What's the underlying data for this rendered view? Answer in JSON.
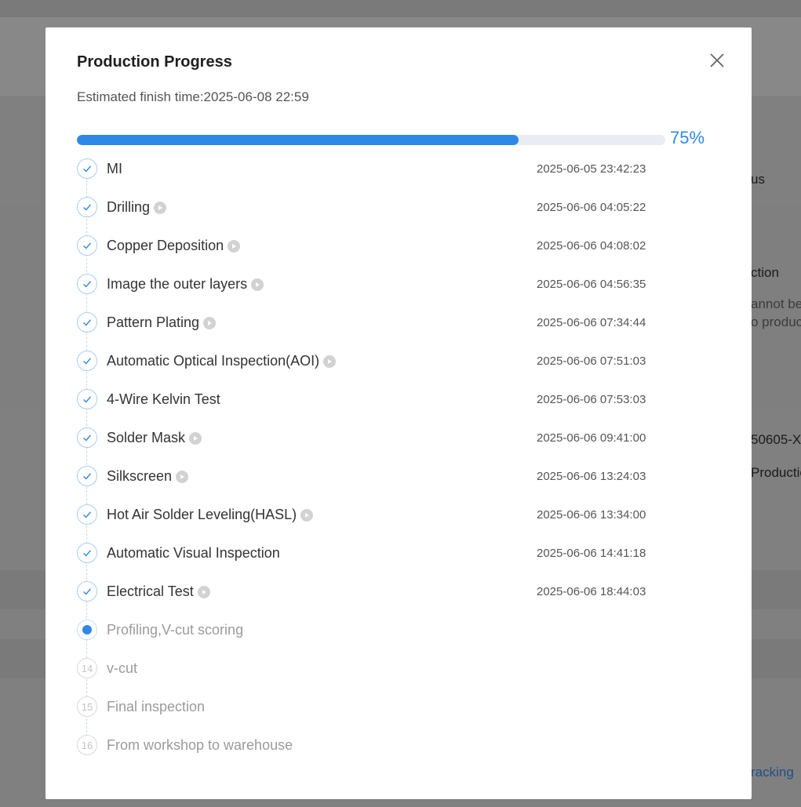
{
  "background": {
    "fragments": [
      "us",
      "ction",
      "annot be",
      "o produc",
      "50605-X",
      "Productio",
      "racking"
    ]
  },
  "modal": {
    "title": "Production Progress",
    "close_icon": "close-icon",
    "estimated_finish": "Estimated finish time:2025-06-08 22:59",
    "progress": {
      "percent_label": "75%",
      "value": 0.75,
      "color": "#2d88e6"
    },
    "steps": [
      {
        "label": "MI",
        "time": "2025-06-05 23:42:23",
        "status": "done",
        "has_play": false
      },
      {
        "label": "Drilling",
        "time": "2025-06-06 04:05:22",
        "status": "done",
        "has_play": true
      },
      {
        "label": "Copper Deposition",
        "time": "2025-06-06 04:08:02",
        "status": "done",
        "has_play": true
      },
      {
        "label": "Image the outer layers",
        "time": "2025-06-06 04:56:35",
        "status": "done",
        "has_play": true
      },
      {
        "label": "Pattern Plating",
        "time": "2025-06-06 07:34:44",
        "status": "done",
        "has_play": true
      },
      {
        "label": "Automatic Optical Inspection(AOI)",
        "time": "2025-06-06 07:51:03",
        "status": "done",
        "has_play": true
      },
      {
        "label": "4-Wire Kelvin Test",
        "time": "2025-06-06 07:53:03",
        "status": "done",
        "has_play": false
      },
      {
        "label": "Solder Mask",
        "time": "2025-06-06 09:41:00",
        "status": "done",
        "has_play": true
      },
      {
        "label": "Silkscreen",
        "time": "2025-06-06 13:24:03",
        "status": "done",
        "has_play": true
      },
      {
        "label": "Hot Air Solder Leveling(HASL)",
        "time": "2025-06-06 13:34:00",
        "status": "done",
        "has_play": true
      },
      {
        "label": "Automatic Visual Inspection",
        "time": "2025-06-06 14:41:18",
        "status": "done",
        "has_play": false
      },
      {
        "label": "Electrical Test",
        "time": "2025-06-06 18:44:03",
        "status": "done",
        "has_play": true
      },
      {
        "label": "Profiling,V-cut scoring",
        "time": "",
        "status": "current",
        "has_play": false
      },
      {
        "label": "v-cut",
        "time": "",
        "status": "pending",
        "number": "14",
        "has_play": false
      },
      {
        "label": "Final inspection",
        "time": "",
        "status": "pending",
        "number": "15",
        "has_play": false
      },
      {
        "label": "From workshop to warehouse",
        "time": "",
        "status": "pending",
        "number": "16",
        "has_play": false
      }
    ]
  }
}
